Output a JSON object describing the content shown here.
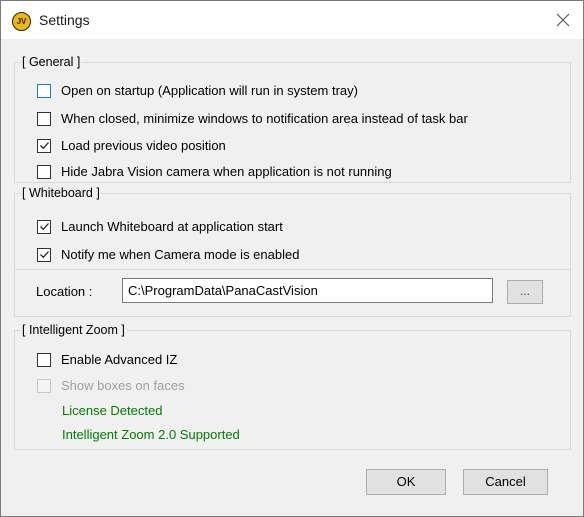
{
  "window": {
    "title": "Settings",
    "icon_text": "JV",
    "close_icon": "close-icon"
  },
  "general": {
    "legend": "[ General ]",
    "items": [
      {
        "label": "Open on startup (Application will run in system tray)",
        "checked": false
      },
      {
        "label": "When closed, minimize windows to notification area instead of task bar",
        "checked": false
      },
      {
        "label": "Load previous video position",
        "checked": true
      },
      {
        "label": "Hide Jabra Vision camera when application is not running",
        "checked": false
      }
    ]
  },
  "whiteboard": {
    "legend": "[ Whiteboard ]",
    "items": [
      {
        "label": "Launch Whiteboard at application start",
        "checked": true
      },
      {
        "label": "Notify me when Camera mode is enabled",
        "checked": true
      }
    ],
    "location_label": "Location :",
    "location_value": "C:\\ProgramData\\PanaCastVision",
    "browse_label": "..."
  },
  "intelligent_zoom": {
    "legend": "[ Intelligent Zoom ]",
    "enable_label": "Enable Advanced IZ",
    "enable_checked": false,
    "boxes_label": "Show boxes on faces",
    "boxes_checked": false,
    "license_status": "License Detected",
    "support_status": "Intelligent Zoom 2.0 Supported"
  },
  "buttons": {
    "ok": "OK",
    "cancel": "Cancel"
  },
  "colors": {
    "status_green": "#008000",
    "focus_blue": "#1979ca",
    "icon_yellow": "#f2b705"
  }
}
